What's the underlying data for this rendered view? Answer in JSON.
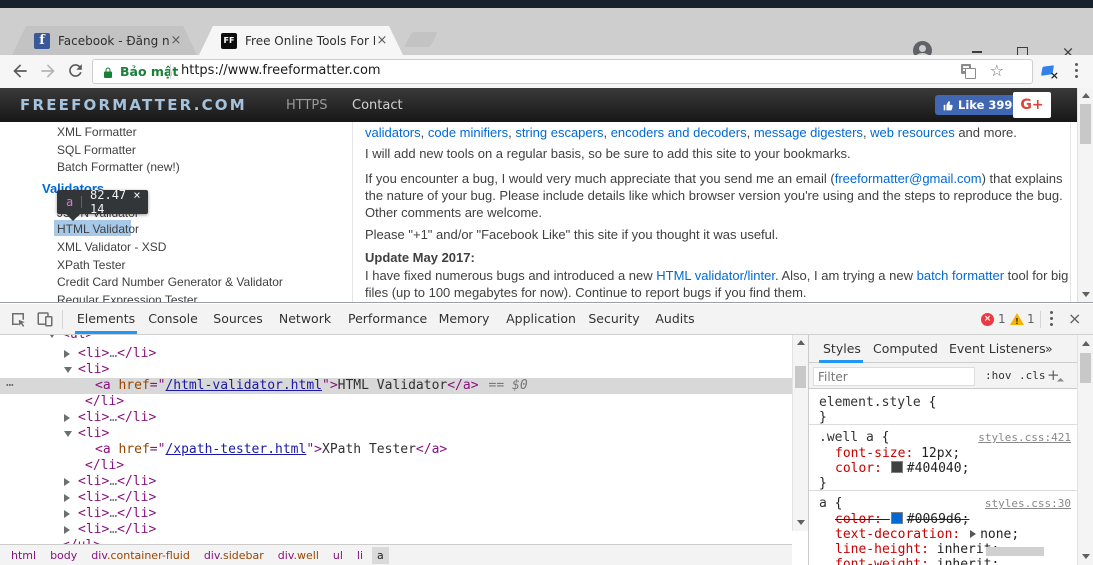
{
  "colors": {
    "facebook_blue": "#4267b2",
    "gplus_red": "#db4437",
    "secure_green": "#188038",
    "brand_blue": "#a6c3dd",
    "link_blue": "#0069d6",
    "devtools_accent": "#2196f3",
    "error_red": "#eb3941",
    "warning_yellow": "#f5b400",
    "inspect_highlight": "#6fa8dc",
    "selection_gray": "#d8d8d8"
  },
  "browser": {
    "tabs": [
      {
        "title": "Facebook - Đăng nhập h"
      },
      {
        "title": "Free Online Tools For Dev"
      }
    ],
    "omnibox": {
      "security_label": "Bảo mật",
      "url": "https://www.freeformatter.com"
    }
  },
  "site": {
    "header": {
      "brand": "FREEFORMATTER.COM",
      "nav": [
        "HTTPS",
        "Contact"
      ],
      "like_label": "Like",
      "like_count": "399",
      "gplus_label": "G+"
    },
    "sidebar": {
      "items_top": [
        "XML Formatter",
        "SQL Formatter",
        "Batch Formatter (new!)"
      ],
      "heading": "Validators",
      "items": [
        "JSON Validator",
        "HTML Validator",
        "XML Validator - XSD",
        "XPath Tester",
        "Credit Card Number Generator & Validator",
        "Regular Expression Tester"
      ]
    },
    "inspect_tooltip": {
      "tag": "a",
      "size": "82.47 × 14"
    },
    "content": {
      "intro": {
        "l1": "validators",
        "s1": ", ",
        "l2": "code minifiers",
        "s2": ", ",
        "l3": "string escapers",
        "s3": ", ",
        "l4": "encoders and decoders",
        "s4": ", ",
        "l5": "message digesters",
        "s5": ", ",
        "l6": "web resources",
        "tail": " and more."
      },
      "p_bookmarks": "I will add new tools on a regular basis, so be sure to add this site to your bookmarks.",
      "p_bug_a": "If you encounter a bug, I would very much appreciate that you send me an email (",
      "p_bug_link": "freeformatter@gmail.com",
      "p_bug_b": ") that explains the nature of your bug. Please include details like which browser version you're using and the steps to reproduce the bug. Other comments are welcome.",
      "p_plus": "Please \"+1\" and/or \"Facebook Like\" this site if you thought it was useful.",
      "update_heading": "Update May 2017:",
      "p_update_a": "I have fixed numerous bugs and introduced a new ",
      "p_update_link1": "HTML validator/linter",
      "p_update_b": ". Also, I am trying a new ",
      "p_update_link2": "batch formatter",
      "p_update_c": " tool for big files (up to 100 megabytes for now). Continue to report bugs if you find them."
    }
  },
  "devtools": {
    "tabs": [
      "Elements",
      "Console",
      "Sources",
      "Network",
      "Performance",
      "Memory",
      "Application",
      "Security",
      "Audits"
    ],
    "active_tab": "Elements",
    "error_count": "1",
    "warning_count": "1",
    "tree": {
      "ul_open": "<ul>",
      "ul_close": "</ul>",
      "li_open": "<li>",
      "li_close": "</li>",
      "ellipsis": "…",
      "gutter": "⋯",
      "selected": {
        "tag": "<a ",
        "attr": "href",
        "eq": "=\"",
        "value": "/html-validator.html",
        "q": "\">",
        "text": "HTML Validator",
        "close": "</a>",
        "marker": "== $0"
      },
      "xpath": {
        "tag": "<a ",
        "attr": "href",
        "eq": "=\"",
        "value": "/xpath-tester.html",
        "q": "\">",
        "text": "XPath Tester",
        "close": "</a>"
      }
    },
    "crumbs": [
      {
        "tag": "html",
        "cls": ""
      },
      {
        "tag": "body",
        "cls": ""
      },
      {
        "tag": "div",
        "cls": ".container-fluid"
      },
      {
        "tag": "div",
        "cls": ".sidebar"
      },
      {
        "tag": "div",
        "cls": ".well"
      },
      {
        "tag": "ul",
        "cls": ""
      },
      {
        "tag": "li",
        "cls": ""
      },
      {
        "tag": "a",
        "cls": ""
      }
    ],
    "styles_pane": {
      "tabs": [
        "Styles",
        "Computed",
        "Event Listeners"
      ],
      "more": "»",
      "filter_placeholder": "Filter",
      "hov": ":hov",
      "cls": ".cls",
      "plus": "+",
      "rules": {
        "r1": {
          "selector": "element.style",
          "brace_open": "{",
          "brace_close": "}"
        },
        "r2": {
          "selector": ".well a",
          "brace_open": "{",
          "brace_close": "}",
          "source": "styles.css:421",
          "p1n": "font-size",
          "p1v": "12px",
          "p2n": "color",
          "p2v": "#404040"
        },
        "r3": {
          "selector": "a",
          "brace_open": "{",
          "brace_close": "}",
          "source": "styles.css:30",
          "p1n": "color",
          "p1v": "#0069d6",
          "p2n": "text-decoration",
          "p2v": "none",
          "p3n": "line-height",
          "p3v": "inherit",
          "p4n": "font-weight",
          "p4v": "inherit"
        }
      }
    }
  }
}
